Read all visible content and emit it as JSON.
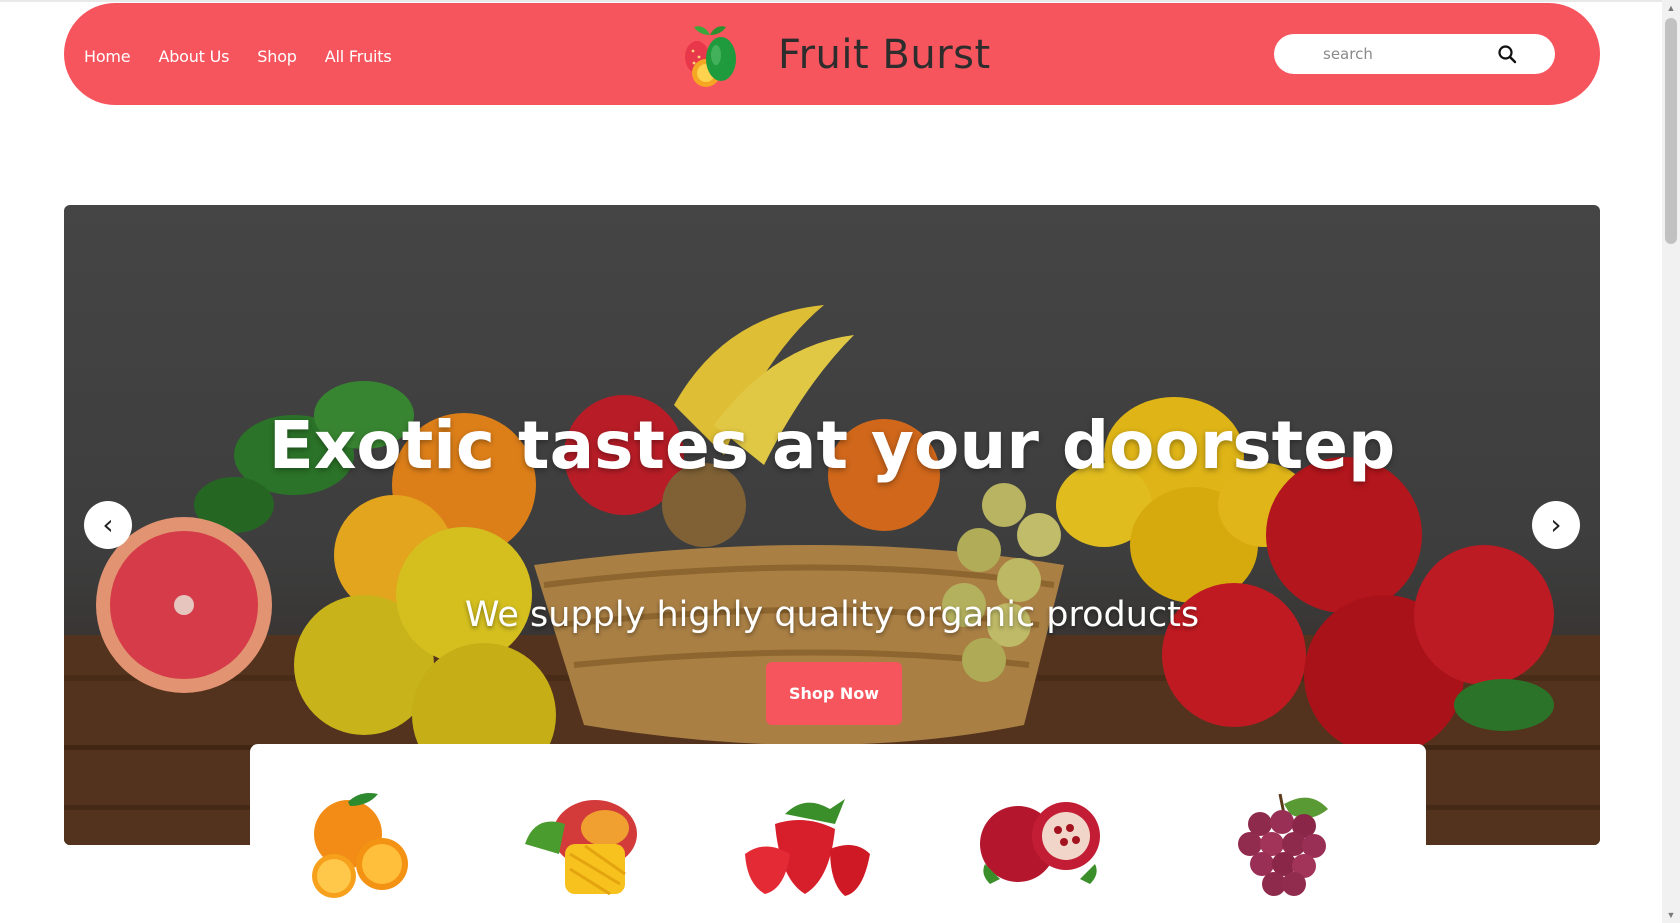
{
  "nav": {
    "items": [
      {
        "label": "Home"
      },
      {
        "label": "About Us"
      },
      {
        "label": "Shop"
      },
      {
        "label": "All Fruits"
      }
    ]
  },
  "brand": {
    "name": "Fruit Burst"
  },
  "search": {
    "placeholder": "search"
  },
  "hero": {
    "title": "Exotic tastes at your doorstep",
    "subtitle": "We supply highly quality organic products",
    "cta_label": "Shop Now",
    "prev_label": "‹",
    "next_label": "›"
  },
  "fruits": [
    "orange",
    "mango",
    "strawberry",
    "pomegranate",
    "grapes"
  ],
  "colors": {
    "accent": "#f7555e",
    "text_dark": "#2d2d2d"
  }
}
